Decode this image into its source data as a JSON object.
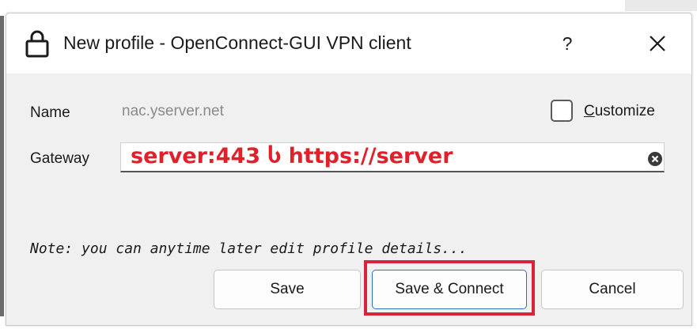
{
  "window": {
    "title": "New profile - OpenConnect-GUI VPN client",
    "help_label": "?",
    "icon": "lock-icon"
  },
  "form": {
    "name_label": "Name",
    "name_value": "nac.yserver.net",
    "customize_label_u": "C",
    "customize_label_rest": "ustomize",
    "gateway_label": "Gateway",
    "gateway_value": "server:443  Ⴑ https://server"
  },
  "note": "Note: you can anytime later edit profile details...",
  "buttons": {
    "save": "Save",
    "save_connect": "Save & Connect",
    "cancel": "Cancel"
  },
  "colors": {
    "annotation": "#e0202a",
    "highlight_box": "#d8243a",
    "focus_border": "#2f6fbe"
  }
}
